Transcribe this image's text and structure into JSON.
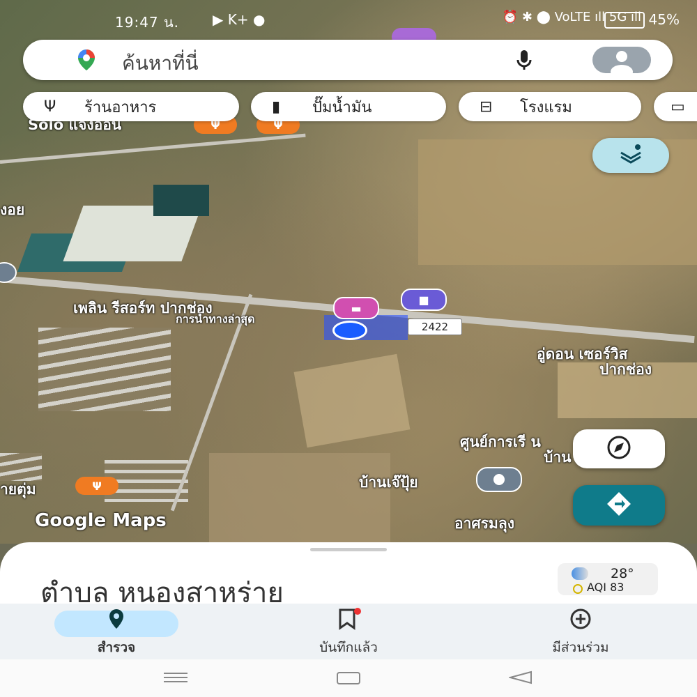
{
  "status": {
    "time": "19:47 น.",
    "left_icons": "▶ K+ ●",
    "right_icons": "⏰ ✱ ⬤ VoLTE ıll 5G ıll",
    "battery": "45%"
  },
  "search": {
    "placeholder": "ค้นหาที่นี่"
  },
  "chips": [
    {
      "icon": "restaurant-icon",
      "label": "ร้านอาหาร"
    },
    {
      "icon": "gas-station-icon",
      "label": "ปั๊มน้ำมัน"
    },
    {
      "icon": "hotel-icon",
      "label": "โรงแรม"
    }
  ],
  "map": {
    "labels": {
      "resort": "เพลิน รีสอร์ท ปากช่อง",
      "recent": "การนำทางล่าสุด",
      "road_number": "2422",
      "oodon_1": "อู่ดอน เซอร์วิส",
      "oodon_2": "ปากช่อง",
      "center_1": "ศูนย์การเรี  น",
      "center_2": "บ้าน  ว",
      "baan_jao": "บ้านเจ๊ปุ้ย",
      "ashram": "อาศรมลุง",
      "left_1": "งอย",
      "left_2": "ายตุ่ม",
      "top_label": "Solo แจ้งออน",
      "watermark": "Google Maps"
    }
  },
  "sheet": {
    "title": "ตำบล หนองสาหร่าย"
  },
  "weather": {
    "temp": "28°",
    "aqi": "AQI 83"
  },
  "bottom_nav": [
    {
      "label": "สำรวจ",
      "icon": "location-pin-icon",
      "active": true
    },
    {
      "label": "บันทึกแล้ว",
      "icon": "bookmark-icon",
      "active": false
    },
    {
      "label": "มีส่วนร่วม",
      "icon": "add-circle-icon",
      "active": false
    }
  ],
  "colors": {
    "accent_teal": "#0f7b8a",
    "active_nav": "#c2e7ff",
    "restaurant_orange": "#f07b22",
    "hotel_pink": "#d14fb0",
    "blue_dot": "#1a5cff"
  }
}
